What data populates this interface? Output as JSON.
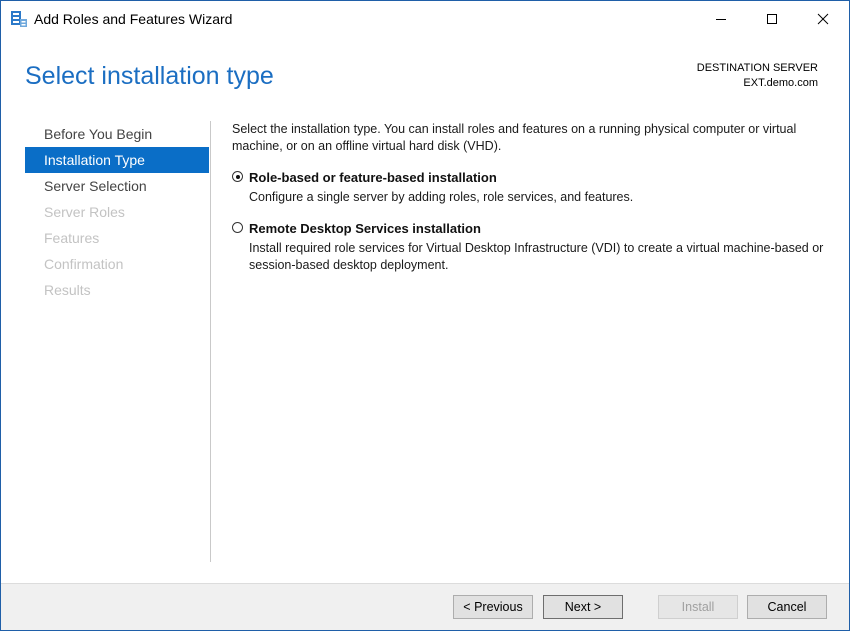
{
  "window": {
    "title": "Add Roles and Features Wizard"
  },
  "header": {
    "page_title": "Select installation type",
    "destination_label": "DESTINATION SERVER",
    "destination_value": "EXT.demo.com"
  },
  "sidebar": {
    "items": [
      {
        "label": "Before You Begin",
        "state": "normal"
      },
      {
        "label": "Installation Type",
        "state": "active"
      },
      {
        "label": "Server Selection",
        "state": "normal"
      },
      {
        "label": "Server Roles",
        "state": "disabled"
      },
      {
        "label": "Features",
        "state": "disabled"
      },
      {
        "label": "Confirmation",
        "state": "disabled"
      },
      {
        "label": "Results",
        "state": "disabled"
      }
    ]
  },
  "main": {
    "intro": "Select the installation type. You can install roles and features on a running physical computer or virtual machine, or on an offline virtual hard disk (VHD).",
    "options": [
      {
        "title": "Role-based or feature-based installation",
        "description": "Configure a single server by adding roles, role services, and features.",
        "selected": true
      },
      {
        "title": "Remote Desktop Services installation",
        "description": "Install required role services for Virtual Desktop Infrastructure (VDI) to create a virtual machine-based or session-based desktop deployment.",
        "selected": false
      }
    ]
  },
  "footer": {
    "previous_label": "< Previous",
    "next_label": "Next >",
    "install_label": "Install",
    "cancel_label": "Cancel"
  },
  "colors": {
    "accent": "#0a6ec7",
    "heading": "#1b6ec2",
    "disabled_text": "#c3c3c3"
  },
  "icons": {
    "app": "server-manager-icon",
    "minimize": "minimize-icon",
    "maximize": "maximize-icon",
    "close": "close-icon"
  }
}
